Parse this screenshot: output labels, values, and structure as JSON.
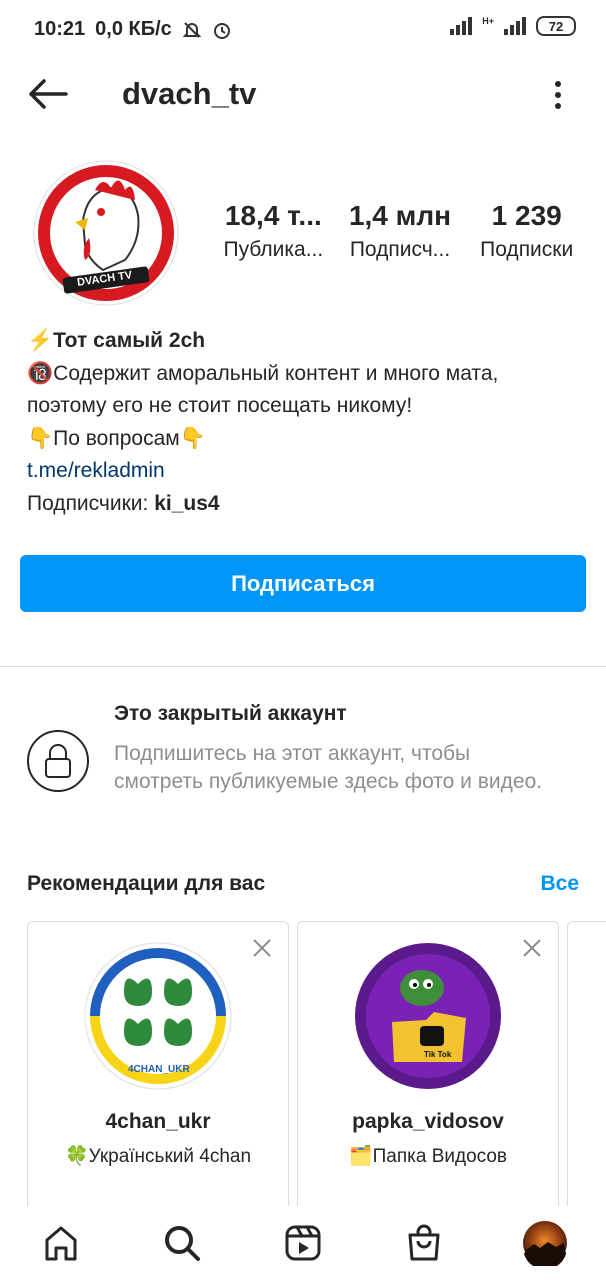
{
  "status": {
    "time": "10:21",
    "speed": "0,0 КБ/с",
    "battery": "72",
    "network": "H+"
  },
  "header": {
    "username": "dvach_tv"
  },
  "profile": {
    "avatar_text": "DVACH TV",
    "stats": [
      {
        "value": "18,4 т...",
        "label": "Публика..."
      },
      {
        "value": "1,4 млн",
        "label": "Подписч..."
      },
      {
        "value": "1 239",
        "label": "Подписки"
      }
    ],
    "bio": {
      "line1": "⚡Тот самый 2ch",
      "line2": "🔞Содержит аморальный контент и много мата, поэтому его не стоит посещать никому!",
      "line3": "👇По вопросам👇",
      "link": "t.me/rekladmin",
      "followers_prefix": "Подписчики: ",
      "followers_name": "ki_us4"
    },
    "follow_label": "Подписаться"
  },
  "private": {
    "title": "Это закрытый аккаунт",
    "desc": "Подпишитесь на этот аккаунт, чтобы смотреть публикуемые здесь фото и видео."
  },
  "recommendations": {
    "title": "Рекомендации для вас",
    "see_all": "Все",
    "cards": [
      {
        "name": "4chan_ukr",
        "desc": "🍀Український 4chan",
        "avatar_text": "4CHAN_UKR"
      },
      {
        "name": "papka_vidosov",
        "desc": "🗂️Папка Видосов",
        "avatar_text": "Tik Tok"
      }
    ]
  },
  "colors": {
    "accent": "#0095f6",
    "link": "#00376b",
    "muted": "#8e8e8e"
  }
}
